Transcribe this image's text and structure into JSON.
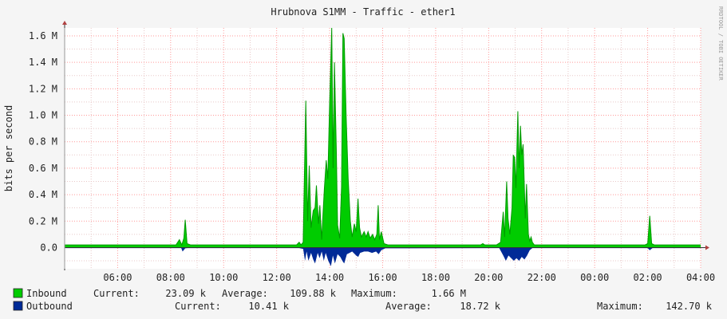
{
  "chart_data": {
    "type": "area",
    "title": "Hrubnova S1MM - Traffic - ether1",
    "ylabel": "bits per second",
    "watermark": "RRDTOOL / TOBI OETIKER",
    "y_ticks": [
      "1.6 M",
      "1.4 M",
      "1.2 M",
      "1.0 M",
      "0.8 M",
      "0.6 M",
      "0.4 M",
      "0.2 M",
      "0.0"
    ],
    "y_tick_values": [
      1.6,
      1.4,
      1.2,
      1.0,
      0.8,
      0.6,
      0.4,
      0.2,
      0.0
    ],
    "x_ticks": [
      "06:00",
      "08:00",
      "10:00",
      "12:00",
      "14:00",
      "16:00",
      "18:00",
      "20:00",
      "22:00",
      "00:00",
      "02:00",
      "04:00"
    ],
    "x_tick_hours": [
      6,
      8,
      10,
      12,
      14,
      16,
      18,
      20,
      22,
      24,
      26,
      28
    ],
    "xlim_hours": [
      4.0,
      28.0
    ],
    "ylim_M": [
      -0.16,
      1.66
    ],
    "colors": {
      "inbound": "#00cc00",
      "inbound_line": "#009900",
      "outbound": "#002a97",
      "grid_major": "#ff9999",
      "grid_minor": "#e8c8c8",
      "axis": "#333333",
      "background": "#f5f5f5",
      "plot_background": "#ffffff"
    },
    "series": [
      {
        "name": "Inbound",
        "units": "M",
        "points": [
          [
            4.0,
            0.02
          ],
          [
            8.2,
            0.02
          ],
          [
            8.33,
            0.06
          ],
          [
            8.42,
            0.02
          ],
          [
            8.5,
            0.07
          ],
          [
            8.55,
            0.21
          ],
          [
            8.62,
            0.03
          ],
          [
            8.75,
            0.02
          ],
          [
            10.5,
            0.02
          ],
          [
            11.5,
            0.02
          ],
          [
            12.75,
            0.02
          ],
          [
            12.85,
            0.04
          ],
          [
            12.92,
            0.02
          ],
          [
            13.0,
            0.04
          ],
          [
            13.1,
            1.11
          ],
          [
            13.17,
            0.2
          ],
          [
            13.23,
            0.62
          ],
          [
            13.3,
            0.15
          ],
          [
            13.38,
            0.28
          ],
          [
            13.45,
            0.3
          ],
          [
            13.5,
            0.47
          ],
          [
            13.58,
            0.18
          ],
          [
            13.63,
            0.32
          ],
          [
            13.7,
            0.06
          ],
          [
            13.75,
            0.26
          ],
          [
            13.8,
            0.44
          ],
          [
            13.87,
            0.66
          ],
          [
            13.93,
            0.52
          ],
          [
            14.0,
            1.1
          ],
          [
            14.08,
            1.66
          ],
          [
            14.13,
            0.6
          ],
          [
            14.18,
            1.4
          ],
          [
            14.25,
            0.75
          ],
          [
            14.3,
            0.17
          ],
          [
            14.38,
            0.07
          ],
          [
            14.45,
            0.46
          ],
          [
            14.5,
            1.62
          ],
          [
            14.55,
            1.58
          ],
          [
            14.62,
            1.0
          ],
          [
            14.7,
            0.52
          ],
          [
            14.78,
            0.2
          ],
          [
            14.85,
            0.08
          ],
          [
            14.93,
            0.18
          ],
          [
            15.0,
            0.12
          ],
          [
            15.07,
            0.37
          ],
          [
            15.13,
            0.15
          ],
          [
            15.2,
            0.08
          ],
          [
            15.3,
            0.12
          ],
          [
            15.38,
            0.08
          ],
          [
            15.45,
            0.12
          ],
          [
            15.53,
            0.07
          ],
          [
            15.62,
            0.1
          ],
          [
            15.7,
            0.06
          ],
          [
            15.78,
            0.1
          ],
          [
            15.83,
            0.32
          ],
          [
            15.88,
            0.06
          ],
          [
            15.95,
            0.12
          ],
          [
            16.05,
            0.03
          ],
          [
            16.2,
            0.02
          ],
          [
            19.7,
            0.02
          ],
          [
            19.78,
            0.03
          ],
          [
            19.85,
            0.02
          ],
          [
            20.3,
            0.02
          ],
          [
            20.45,
            0.04
          ],
          [
            20.55,
            0.27
          ],
          [
            20.6,
            0.08
          ],
          [
            20.68,
            0.5
          ],
          [
            20.73,
            0.22
          ],
          [
            20.8,
            0.1
          ],
          [
            20.88,
            0.3
          ],
          [
            20.93,
            0.7
          ],
          [
            20.98,
            0.68
          ],
          [
            21.03,
            0.45
          ],
          [
            21.1,
            1.03
          ],
          [
            21.15,
            0.6
          ],
          [
            21.2,
            0.92
          ],
          [
            21.25,
            0.7
          ],
          [
            21.3,
            0.78
          ],
          [
            21.38,
            0.22
          ],
          [
            21.43,
            0.48
          ],
          [
            21.5,
            0.1
          ],
          [
            21.55,
            0.05
          ],
          [
            21.6,
            0.08
          ],
          [
            21.65,
            0.04
          ],
          [
            21.72,
            0.02
          ],
          [
            25.9,
            0.02
          ],
          [
            26.0,
            0.03
          ],
          [
            26.08,
            0.24
          ],
          [
            26.15,
            0.03
          ],
          [
            26.25,
            0.02
          ],
          [
            28.0,
            0.02
          ]
        ],
        "legend": {
          "label": "Inbound",
          "current": "23.09 k",
          "average": "109.88 k",
          "maximum": "1.66 M"
        }
      },
      {
        "name": "Outbound",
        "units": "M",
        "points": [
          [
            4.0,
            0.004
          ],
          [
            8.4,
            0.004
          ],
          [
            8.45,
            0.03
          ],
          [
            8.55,
            0.006
          ],
          [
            8.65,
            0.004
          ],
          [
            12.85,
            0.004
          ],
          [
            13.0,
            0.01
          ],
          [
            13.07,
            0.1
          ],
          [
            13.13,
            0.03
          ],
          [
            13.2,
            0.1
          ],
          [
            13.3,
            0.04
          ],
          [
            13.38,
            0.09
          ],
          [
            13.45,
            0.12
          ],
          [
            13.55,
            0.04
          ],
          [
            13.62,
            0.08
          ],
          [
            13.7,
            0.03
          ],
          [
            13.78,
            0.1
          ],
          [
            13.85,
            0.04
          ],
          [
            13.95,
            0.1
          ],
          [
            14.05,
            0.14
          ],
          [
            14.12,
            0.06
          ],
          [
            14.2,
            0.12
          ],
          [
            14.3,
            0.05
          ],
          [
            14.4,
            0.07
          ],
          [
            14.48,
            0.1
          ],
          [
            14.55,
            0.12
          ],
          [
            14.65,
            0.05
          ],
          [
            14.75,
            0.04
          ],
          [
            14.85,
            0.03
          ],
          [
            15.0,
            0.06
          ],
          [
            15.08,
            0.07
          ],
          [
            15.15,
            0.04
          ],
          [
            15.3,
            0.03
          ],
          [
            15.45,
            0.03
          ],
          [
            15.6,
            0.04
          ],
          [
            15.75,
            0.03
          ],
          [
            15.85,
            0.05
          ],
          [
            15.95,
            0.02
          ],
          [
            16.1,
            0.006
          ],
          [
            20.4,
            0.004
          ],
          [
            20.55,
            0.06
          ],
          [
            20.65,
            0.1
          ],
          [
            20.75,
            0.06
          ],
          [
            20.85,
            0.08
          ],
          [
            20.95,
            0.1
          ],
          [
            21.05,
            0.08
          ],
          [
            21.15,
            0.1
          ],
          [
            21.25,
            0.07
          ],
          [
            21.35,
            0.09
          ],
          [
            21.45,
            0.06
          ],
          [
            21.55,
            0.02
          ],
          [
            21.65,
            0.004
          ],
          [
            26.0,
            0.004
          ],
          [
            26.08,
            0.02
          ],
          [
            26.18,
            0.004
          ],
          [
            28.0,
            0.004
          ]
        ],
        "legend": {
          "label": "Outbound",
          "current": "10.41 k",
          "average": "18.72 k",
          "maximum": "142.70 k"
        }
      }
    ]
  },
  "legend_labels": {
    "current": "Current:",
    "average": "Average:",
    "maximum": "Maximum:"
  }
}
